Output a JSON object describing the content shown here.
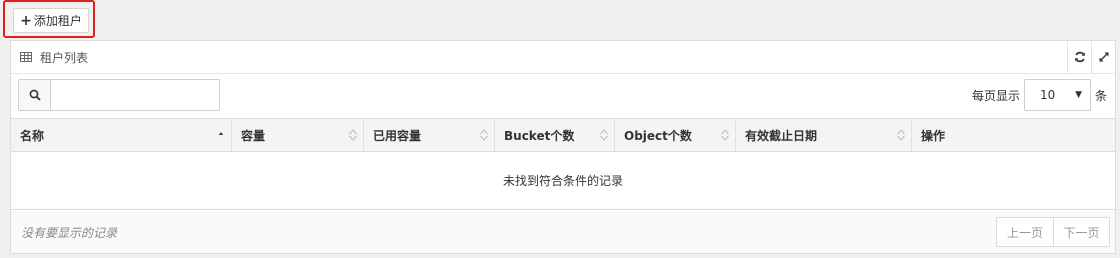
{
  "toolbar": {
    "add_button_label": "添加租户"
  },
  "panel": {
    "title": "租户列表"
  },
  "search": {
    "value": "",
    "placeholder": ""
  },
  "page_size": {
    "label": "每页显示",
    "selected": "10",
    "unit": "条"
  },
  "table": {
    "columns": [
      {
        "label": "名称",
        "sort": "asc"
      },
      {
        "label": "容量",
        "sort": "both"
      },
      {
        "label": "已用容量",
        "sort": "both"
      },
      {
        "label": "Bucket个数",
        "sort": "both"
      },
      {
        "label": "Object个数",
        "sort": "both"
      },
      {
        "label": "有效截止日期",
        "sort": "both"
      },
      {
        "label": "操作",
        "sort": "none"
      }
    ],
    "empty_text": "未找到符合条件的记录"
  },
  "footer": {
    "info": "没有要显示的记录",
    "prev_label": "上一页",
    "next_label": "下一页"
  },
  "colors": {
    "highlight": "#e02020",
    "header_bg": "#f4f4f4",
    "page_bg": "#f0f0f0"
  }
}
